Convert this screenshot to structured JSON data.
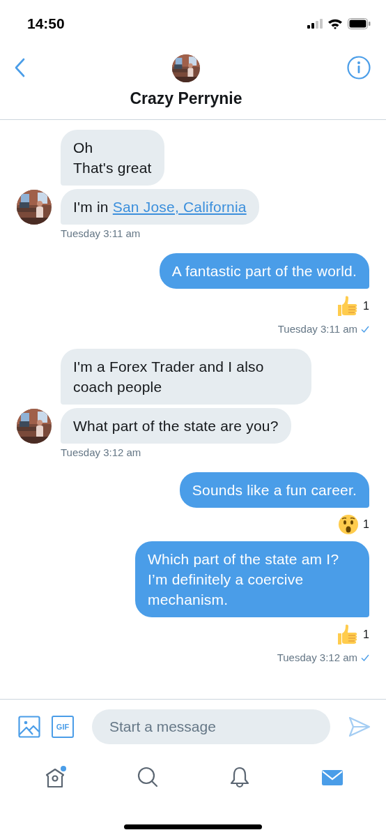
{
  "status_bar": {
    "time": "14:50"
  },
  "header": {
    "title": "Crazy Perrynie"
  },
  "groups": [
    {
      "kind": "received",
      "bubbles": [
        {
          "parts": [
            {
              "text": "Oh\nThat's great"
            }
          ]
        },
        {
          "parts": [
            {
              "text": "I'm in "
            },
            {
              "text": "San Jose, California",
              "kind": "link"
            }
          ]
        }
      ],
      "timestamp": "Tuesday 3:11 am"
    },
    {
      "kind": "sent",
      "bubbles": [
        {
          "parts": [
            {
              "text": "A fantastic part of the world."
            }
          ],
          "reaction": {
            "kind": "thumbs-up",
            "count": "1"
          }
        }
      ],
      "timestamp": "Tuesday 3:11 am",
      "read": true
    },
    {
      "kind": "received",
      "bubbles": [
        {
          "parts": [
            {
              "text": "I'm a Forex Trader and I also coach people"
            }
          ]
        },
        {
          "parts": [
            {
              "text": "What part of the state are you?"
            }
          ]
        }
      ],
      "timestamp": "Tuesday 3:12 am"
    },
    {
      "kind": "sent",
      "bubbles": [
        {
          "parts": [
            {
              "text": "Sounds like a fun career."
            }
          ],
          "reaction": {
            "kind": "surprised",
            "count": "1"
          }
        },
        {
          "parts": [
            {
              "text": "Which part of the state am I? I’m definitely a coercive mechanism."
            }
          ],
          "reaction": {
            "kind": "thumbs-up",
            "count": "1"
          }
        }
      ],
      "timestamp": "Tuesday 3:12 am",
      "read": true
    }
  ],
  "composer": {
    "gif_label": "GIF",
    "placeholder": "Start a message"
  },
  "tab_bar": [
    {
      "kind": "home",
      "selected": false,
      "badge": true
    },
    {
      "kind": "search",
      "selected": false,
      "badge": false
    },
    {
      "kind": "notifications",
      "selected": false,
      "badge": false
    },
    {
      "kind": "messages",
      "selected": true,
      "badge": false
    }
  ]
}
